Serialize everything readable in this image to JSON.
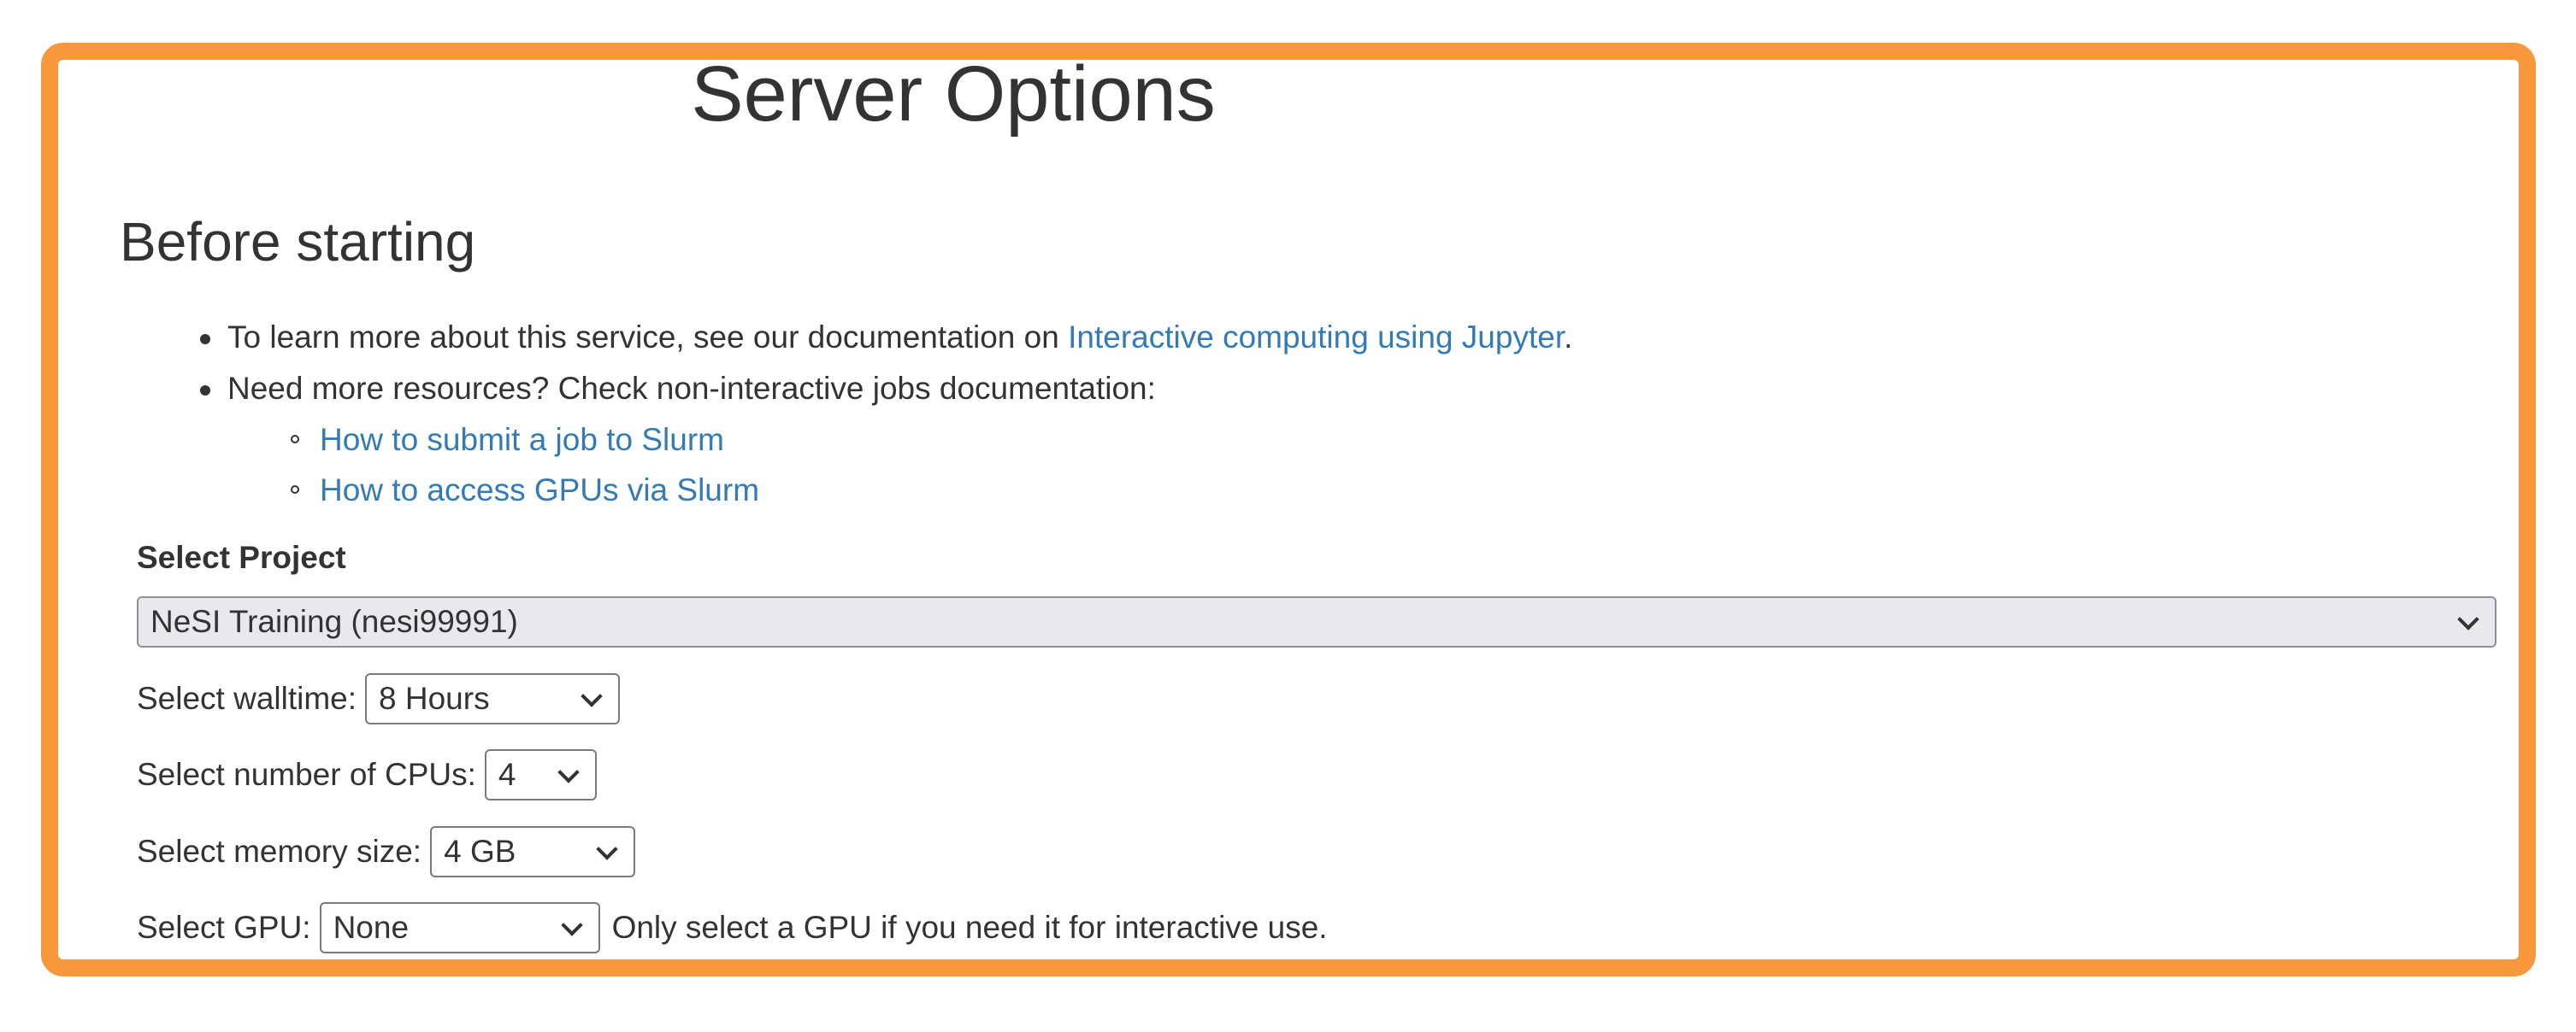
{
  "page_title": "Server Options",
  "before_starting": {
    "heading": "Before starting",
    "bullet1_prefix": "To learn more about this service, see our documentation on ",
    "bullet1_link": "Interactive computing using Jupyter",
    "bullet1_suffix": ".",
    "bullet2": "Need more resources? Check non-interactive jobs documentation:",
    "sub_links": [
      "How to submit a job to Slurm",
      "How to access GPUs via Slurm"
    ]
  },
  "project": {
    "label": "Select Project",
    "value": "NeSI Training (nesi99991)"
  },
  "walltime": {
    "label": "Select walltime:",
    "value": "8 Hours"
  },
  "cpus": {
    "label": "Select number of CPUs:",
    "value": "4"
  },
  "memory": {
    "label": "Select memory size:",
    "value": "4 GB"
  },
  "gpu": {
    "label": "Select GPU:",
    "value": "None",
    "hint": "Only select a GPU if you need it for interactive use."
  },
  "colors": {
    "frame_border": "#f8973b",
    "link": "#337ab7",
    "text": "#333333"
  }
}
